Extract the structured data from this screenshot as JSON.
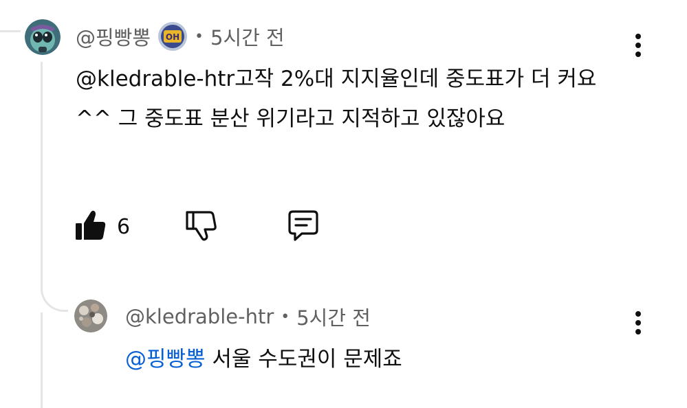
{
  "comment": {
    "author": "@핑빵뽕",
    "time": "5시간 전",
    "separator": "•",
    "badge_text": "OH",
    "text": "@kledrable-htr고작 2%대 지지율인데 중도표가 더 커요^^ 그 중도표 분산 위기라고 지적하고 있잖아요",
    "likes": "6",
    "icons": {
      "like": "thumbs-up-filled-icon",
      "dislike": "thumbs-down-icon",
      "reply": "comment-icon",
      "more": "more-vertical-icon"
    }
  },
  "reply": {
    "author": "@kledrable-htr",
    "time": "5시간 전",
    "separator": "•",
    "mention": "@핑빵뽕",
    "text": " 서울 수도권이 문제죠"
  },
  "colors": {
    "mention": "#065fd4",
    "meta": "#606060",
    "text": "#0f0f0f",
    "thread_line": "#e5e5e5"
  }
}
